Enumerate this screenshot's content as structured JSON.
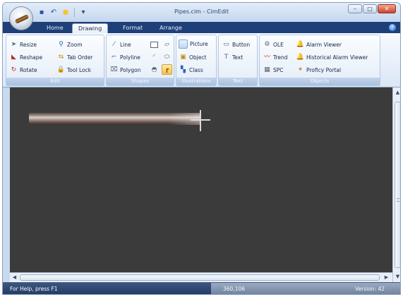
{
  "window": {
    "title": "Pipes.cim - CimEdit",
    "controls": {
      "minimize": "–",
      "maximize": "□",
      "close": "✕"
    }
  },
  "quick_access": [
    {
      "name": "save-icon",
      "glyph": "▪"
    },
    {
      "name": "undo-icon",
      "glyph": "↶"
    },
    {
      "name": "bulb-icon",
      "glyph": "●"
    },
    {
      "name": "customize-icon",
      "glyph": "▾"
    }
  ],
  "tabs": [
    {
      "label": "Home",
      "active": false
    },
    {
      "label": "Drawing",
      "active": true
    },
    {
      "label": "Format",
      "active": false
    },
    {
      "label": "Arrange",
      "active": false
    }
  ],
  "ribbon": {
    "edit": {
      "label": "Edit",
      "items": [
        "Resize",
        "Zoom",
        "Reshape",
        "Tab Order",
        "Rotate",
        "Tool Lock"
      ]
    },
    "shapes": {
      "label": "Shapes",
      "items": [
        "Line",
        "Polyline",
        "Polygon"
      ]
    },
    "illustrations": {
      "label": "Illustrations",
      "items": [
        "Picture",
        "Object",
        "Class"
      ]
    },
    "text": {
      "label": "Text",
      "items": [
        "Button",
        "Text"
      ]
    },
    "objects": {
      "label": "Objects",
      "items": [
        "OLE",
        "Trend",
        "SPC",
        "Alarm Viewer",
        "Historical Alarm Viewer",
        "Proficy Portal"
      ]
    }
  },
  "status": {
    "help": "For Help, press F1",
    "coords": "360,106",
    "version": "Version: 42"
  },
  "colors": {
    "canvas": "#3b3b3b",
    "status_bar": "#203a64",
    "tab_bar": "#1f3f78"
  }
}
